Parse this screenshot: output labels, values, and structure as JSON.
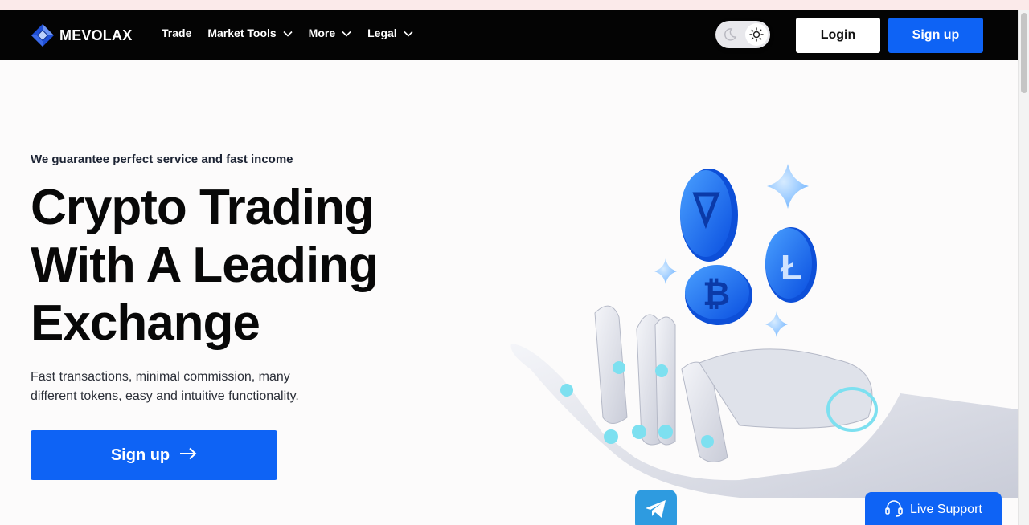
{
  "brand": {
    "name": "MEVOLAX",
    "accent_color": "#0e63f5",
    "logo_icon": "diamond-cube-icon"
  },
  "nav": {
    "items": [
      {
        "label": "Trade",
        "has_dropdown": false
      },
      {
        "label": "Market Tools",
        "has_dropdown": true
      },
      {
        "label": "More",
        "has_dropdown": true
      },
      {
        "label": "Legal",
        "has_dropdown": true
      }
    ],
    "theme_toggle": {
      "left_icon": "moon-icon",
      "right_icon": "sun-icon",
      "active": "light"
    },
    "login_label": "Login",
    "signup_label": "Sign up"
  },
  "hero": {
    "tagline": "We guarantee perfect service and fast income",
    "title_lines": [
      "Crypto Trading",
      "With A Leading",
      "Exchange"
    ],
    "description": "Fast transactions, minimal commission, many different tokens, easy and intuitive functionality.",
    "cta_label": "Sign up",
    "cta_icon": "arrow-right-icon",
    "illustration": {
      "subject": "robot-hand-with-crypto-coins",
      "coins": [
        "toncoin",
        "litecoin",
        "bitcoin"
      ]
    }
  },
  "floating": {
    "telegram_icon": "telegram-icon",
    "live_support_label": "Live Support",
    "live_support_icon": "headset-icon"
  }
}
